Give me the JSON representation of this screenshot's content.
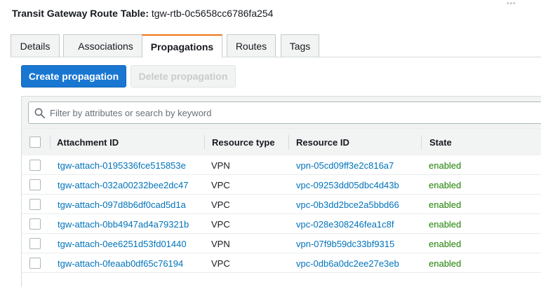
{
  "page": {
    "title_label": "Transit Gateway Route Table:",
    "title_value": "tgw-rtb-0c5658cc6786fa254"
  },
  "tabs": [
    {
      "label": "Details",
      "active": false
    },
    {
      "label": "Associations",
      "active": false
    },
    {
      "label": "Propagations",
      "active": true
    },
    {
      "label": "Routes",
      "active": false
    },
    {
      "label": "Tags",
      "active": false
    }
  ],
  "actions": {
    "create_label": "Create propagation",
    "delete_label": "Delete propagation"
  },
  "filter": {
    "placeholder": "Filter by attributes or search by keyword",
    "icon": "search-icon"
  },
  "table": {
    "columns": [
      "Attachment ID",
      "Resource type",
      "Resource ID",
      "State"
    ],
    "rows": [
      {
        "attachment_id": "tgw-attach-0195336fce515853e",
        "resource_type": "VPN",
        "resource_id": "vpn-05cd09ff3e2c816a7",
        "state": "enabled"
      },
      {
        "attachment_id": "tgw-attach-032a00232bee2dc47",
        "resource_type": "VPC",
        "resource_id": "vpc-09253dd05dbc4d43b",
        "state": "enabled"
      },
      {
        "attachment_id": "tgw-attach-097d8b6df0cad5d1a",
        "resource_type": "VPC",
        "resource_id": "vpc-0b3dd2bce2a5bbd66",
        "state": "enabled"
      },
      {
        "attachment_id": "tgw-attach-0bb4947ad4a79321b",
        "resource_type": "VPC",
        "resource_id": "vpc-028e308246fea1c8f",
        "state": "enabled"
      },
      {
        "attachment_id": "tgw-attach-0ee6251d53fd01440",
        "resource_type": "VPN",
        "resource_id": "vpn-07f9b59dc33bf9315",
        "state": "enabled"
      },
      {
        "attachment_id": "tgw-attach-0feaab0df65c76194",
        "resource_type": "VPC",
        "resource_id": "vpc-0db6a0dc2ee27e3eb",
        "state": "enabled"
      }
    ]
  },
  "colors": {
    "primary_button": "#1977d2",
    "link": "#0073bb",
    "state_enabled": "#1d8102",
    "active_tab_accent": "#ec7211"
  }
}
